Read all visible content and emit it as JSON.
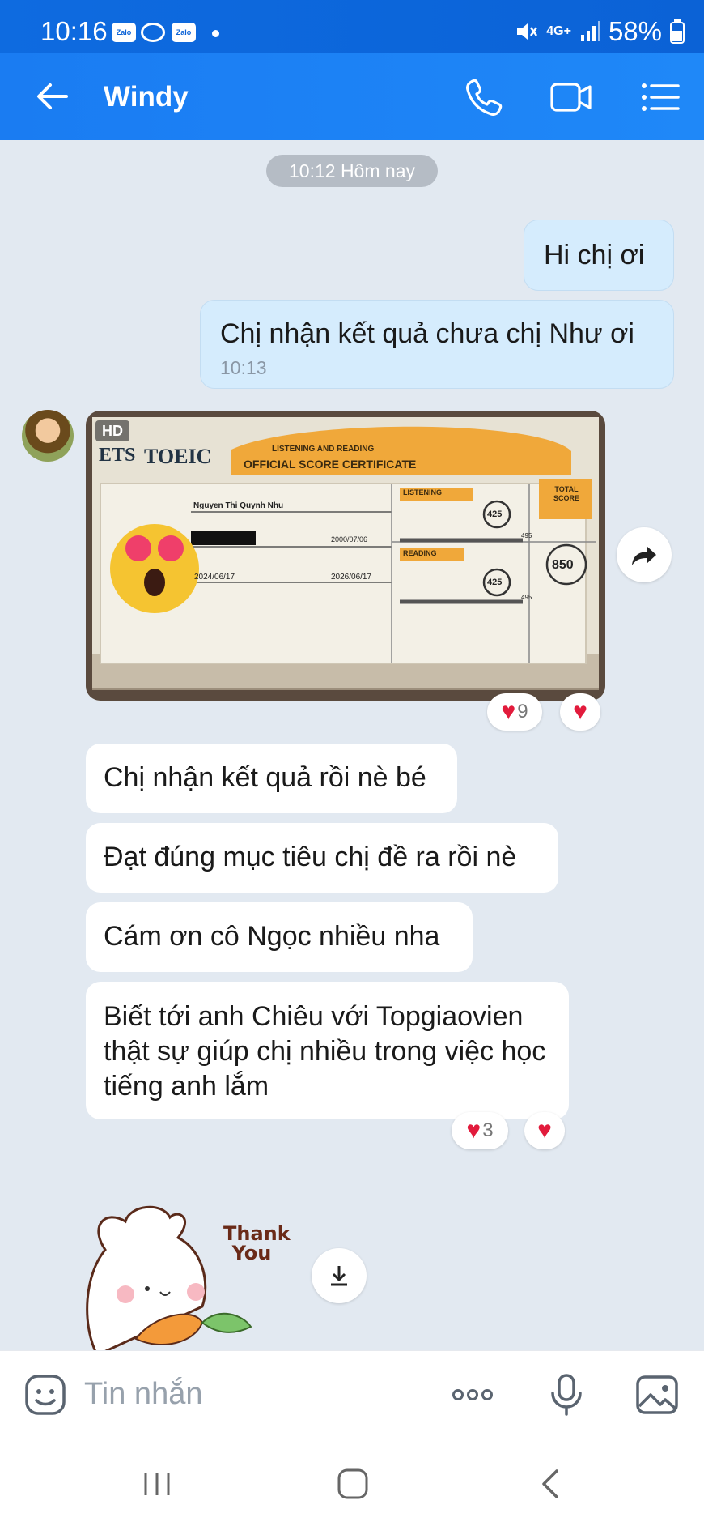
{
  "status_bar": {
    "time": "10:16",
    "badges": [
      "Zalo",
      "Zalo"
    ],
    "network": "4G+",
    "battery": "58%"
  },
  "header": {
    "title": "Windy"
  },
  "chat": {
    "date_separator": "10:12 Hôm nay",
    "messages": [
      {
        "from": "me",
        "text": "Hi chị ơi"
      },
      {
        "from": "me",
        "text": "Chị nhận kết quả chưa chị Như ơi",
        "time": "10:13"
      },
      {
        "from": "them",
        "type": "image",
        "badge": "HD",
        "reaction_count": "9"
      },
      {
        "from": "them",
        "text": "Chị nhận kết quả rồi nè bé"
      },
      {
        "from": "them",
        "text": "Đạt đúng mục tiêu chị đề ra rồi nè"
      },
      {
        "from": "them",
        "text": "Cám ơn cô Ngọc nhiều nha"
      },
      {
        "from": "them",
        "text": "Biết tới anh Chiêu với Topgiaovien thật sự giúp chị nhiều trong việc học tiếng anh lắm",
        "reaction_count": "3"
      },
      {
        "from": "them",
        "type": "sticker",
        "sticker_text": "Thank You"
      }
    ]
  },
  "certificate": {
    "brand": "TOEIC",
    "ets": "ETS",
    "heading_line1": "LISTENING AND READING",
    "heading_line2": "OFFICIAL SCORE CERTIFICATE",
    "name": "Nguyen Thi Quynh Nhu",
    "dob": "2000/07/06",
    "test_date": "2024/06/17",
    "valid_until": "2026/06/17",
    "listening_label": "LISTENING",
    "reading_label": "READING",
    "listening_score": "425",
    "reading_score": "425",
    "max_score": "495",
    "total_label": "TOTAL SCORE",
    "total_score": "850"
  },
  "input_bar": {
    "placeholder": "Tin nhắn"
  },
  "colors": {
    "header": "#1a7cf2",
    "my_bubble": "#d5ecfd",
    "their_bubble": "#ffffff",
    "background": "#e2e9f1",
    "heart": "#e21b3c"
  }
}
